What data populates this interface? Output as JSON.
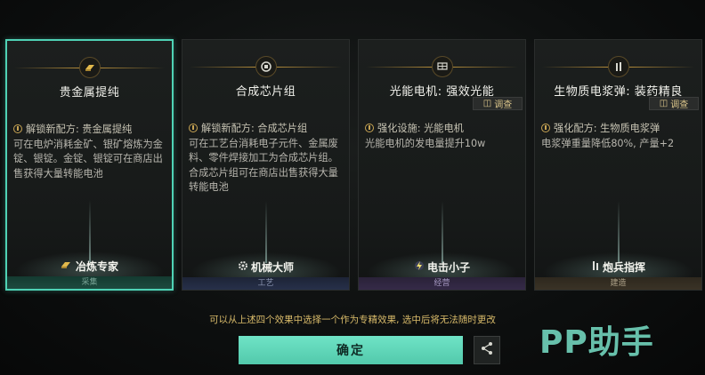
{
  "cards": [
    {
      "title": "贵金属提纯",
      "icon": "gold-ingot-icon",
      "desc_first": "解锁新配方: 贵金属提纯",
      "desc_rest": "可在电炉消耗金矿、银矿熔炼为金锭、银锭。金锭、银锭可在商店出售获得大量转能电池",
      "role": "冶炼专家",
      "role_icon": "smelter-icon",
      "category": "采集",
      "selected": true
    },
    {
      "title": "合成芯片组",
      "icon": "chip-icon",
      "desc_first": "解锁新配方: 合成芯片组",
      "desc_rest": "可在工艺台消耗电子元件、金属废料、零件焊接加工为合成芯片组。合成芯片组可在商店出售获得大量转能电池",
      "role": "机械大师",
      "role_icon": "gear-icon",
      "category": "工艺",
      "selected": false
    },
    {
      "title": "光能电机: 强效光能",
      "icon": "solar-panel-icon",
      "inspect_label": "调查",
      "desc_first": "强化设施: 光能电机",
      "desc_rest": "光能电机的发电量提升10w",
      "role": "电击小子",
      "role_icon": "lightning-icon",
      "category": "经营",
      "selected": false
    },
    {
      "title": "生物质电浆弹: 装药精良",
      "icon": "shell-icon",
      "inspect_label": "调查",
      "desc_first": "强化配方: 生物质电浆弹",
      "desc_rest": "电浆弹重量降低80%, 产量+2",
      "role": "炮兵指挥",
      "role_icon": "artillery-icon",
      "category": "建造",
      "selected": false
    }
  ],
  "note": "可以从上述四个效果中选择一个作为专精效果, 选中后将无法随时更改",
  "confirm_label": "确定",
  "share_icon": "share-icon",
  "watermark": "PP助手",
  "colors": {
    "accent": "#4fd2b5",
    "gold": "#c99b3e",
    "note": "#d9bb6a"
  }
}
